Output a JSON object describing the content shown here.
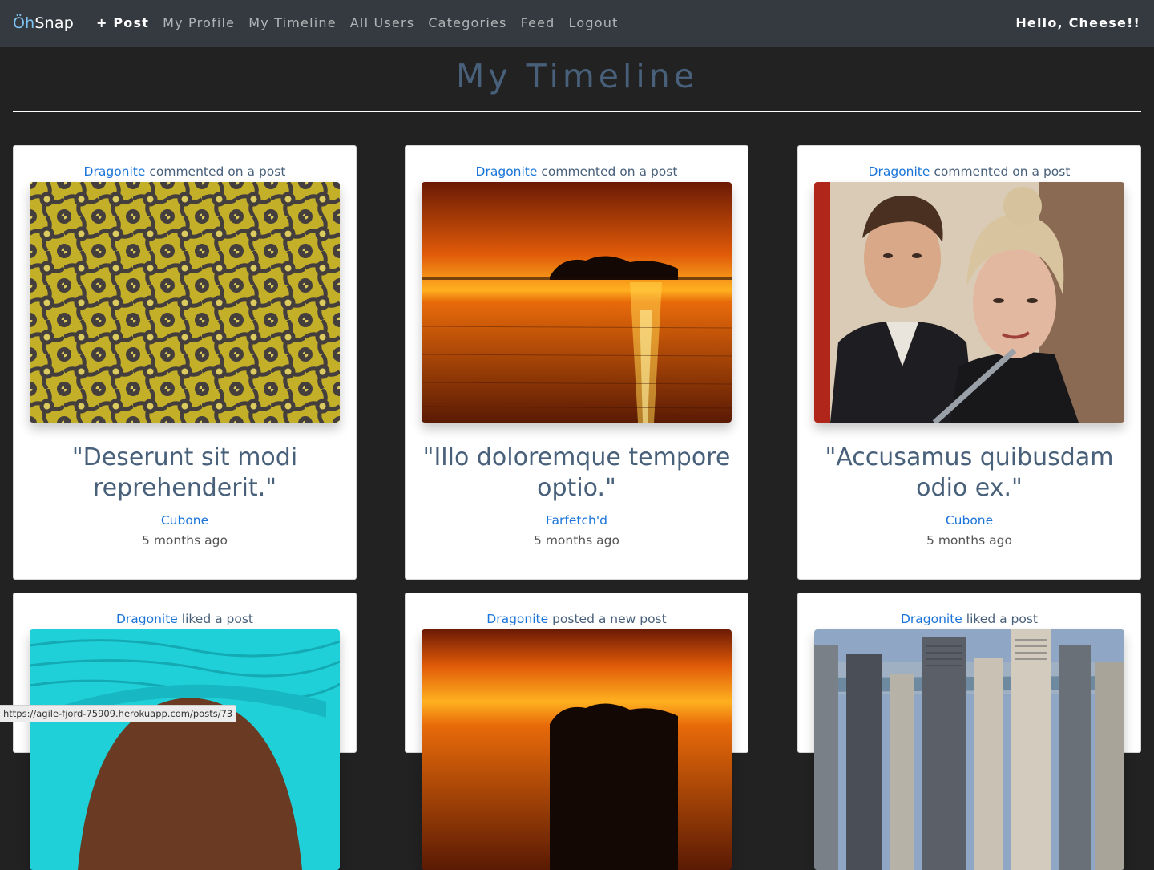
{
  "navbar": {
    "brand_oh": "Öh",
    "brand_snap": "Snap",
    "links": [
      "+ Post",
      "My Profile",
      "My Timeline",
      "All Users",
      "Categories",
      "Feed",
      "Logout"
    ],
    "greeting": "Hello, Cheese!!"
  },
  "page": {
    "title": "My Timeline"
  },
  "cards": [
    {
      "actor": "Dragonite",
      "action": " commented on a post",
      "image": "yellow-tile-pattern",
      "quote": "\"Deserunt sit modi reprehenderit.\"",
      "author": "Cubone",
      "time": "5 months ago"
    },
    {
      "actor": "Dragonite",
      "action": " commented on a post",
      "image": "sunset-over-lake",
      "quote": "\"Illo doloremque tempore optio.\"",
      "author": "Farfetch'd",
      "time": "5 months ago"
    },
    {
      "actor": "Dragonite",
      "action": " commented on a post",
      "image": "couple-portrait",
      "quote": "\"Accusamus quibusdam odio ex.\"",
      "author": "Cubone",
      "time": "5 months ago"
    },
    {
      "actor": "Dragonite",
      "action": " liked a post",
      "image": "turquoise-headwrap"
    },
    {
      "actor": "Dragonite",
      "action": " posted a new post",
      "image": "sunset-over-lake"
    },
    {
      "actor": "Dragonite",
      "action": " liked a post",
      "image": "city-skyline"
    }
  ],
  "status_bar": {
    "url": "https://agile-fjord-75909.herokuapp.com/posts/73"
  },
  "colors": {
    "navbar_bg": "#343a40",
    "page_bg": "#222222",
    "title": "#48607a",
    "link": "#1a74d9",
    "card_bg": "#ffffff"
  }
}
